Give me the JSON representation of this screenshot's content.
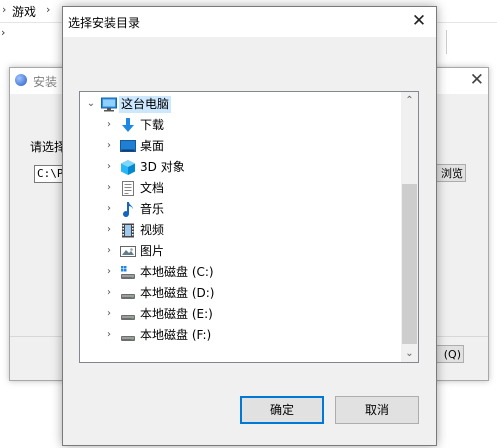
{
  "explorer": {
    "breadcrumb": [
      "游戏"
    ],
    "sep": "›"
  },
  "installer": {
    "title": "安装",
    "label": "请选择",
    "path_value": "C:\\Pr",
    "browse_label": "浏览(B)",
    "bottom_button_label": "(Q)"
  },
  "dialog": {
    "title": "选择安装目录",
    "close_glyph": "✕",
    "tree": {
      "root": {
        "label": "这台电脑",
        "icon": "monitor-icon",
        "expanded": true,
        "selected": true
      },
      "items": [
        {
          "label": "下载",
          "icon": "download-arrow-icon"
        },
        {
          "label": "桌面",
          "icon": "desktop-icon"
        },
        {
          "label": "3D 对象",
          "icon": "3d-cube-icon"
        },
        {
          "label": "文档",
          "icon": "document-icon"
        },
        {
          "label": "音乐",
          "icon": "music-note-icon"
        },
        {
          "label": "视频",
          "icon": "film-icon"
        },
        {
          "label": "图片",
          "icon": "picture-icon"
        },
        {
          "label": "本地磁盘 (C:)",
          "icon": "system-drive-icon"
        },
        {
          "label": "本地磁盘 (D:)",
          "icon": "drive-icon"
        },
        {
          "label": "本地磁盘 (E:)",
          "icon": "drive-icon"
        },
        {
          "label": "本地磁盘 (F:)",
          "icon": "drive-icon"
        }
      ]
    },
    "ok_label": "确定",
    "cancel_label": "取消"
  },
  "colors": {
    "selection": "#cce8ff",
    "default_button_border": "#0078d7",
    "folder_blue": "#1e88e5"
  }
}
